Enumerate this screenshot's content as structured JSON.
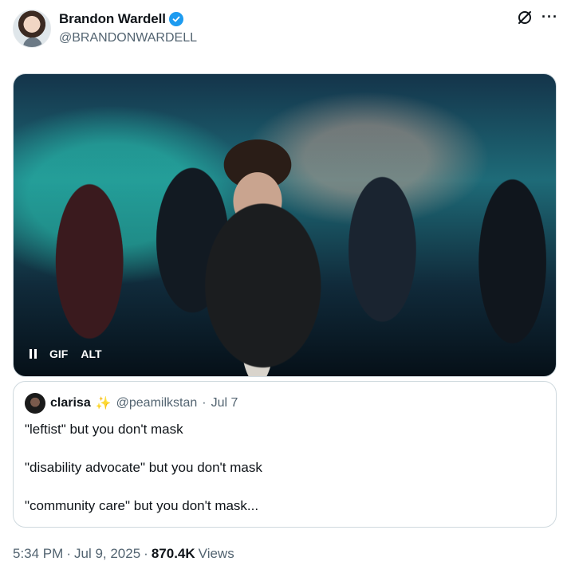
{
  "author": {
    "display_name": "Brandon Wardell",
    "handle": "@BRANDONWARDELL",
    "verified_icon": "verified-badge-icon",
    "verified_color": "#1d9bf0"
  },
  "icons": {
    "grok": "grok-icon",
    "more": "more-options-icon",
    "more_glyph": "···"
  },
  "media": {
    "type": "gif",
    "pause_icon": "pause-icon",
    "gif_label": "GIF",
    "alt_label": "ALT"
  },
  "quoted_tweet": {
    "display_name": "clarisa",
    "emoji": "✨",
    "handle": "@peamilkstan",
    "separator": "·",
    "date": "Jul 7",
    "lines": [
      "\"leftist\" but you don't mask",
      "\"disability advocate\" but you don't mask",
      "\"community care\" but you don't mask..."
    ]
  },
  "footer": {
    "time": "5:34 PM",
    "separator": "·",
    "date": "Jul 9, 2025",
    "views_count": "870.4K",
    "views_label": "Views"
  },
  "colors": {
    "text_primary": "#0f1419",
    "text_secondary": "#536471",
    "border": "#cfd9de"
  }
}
